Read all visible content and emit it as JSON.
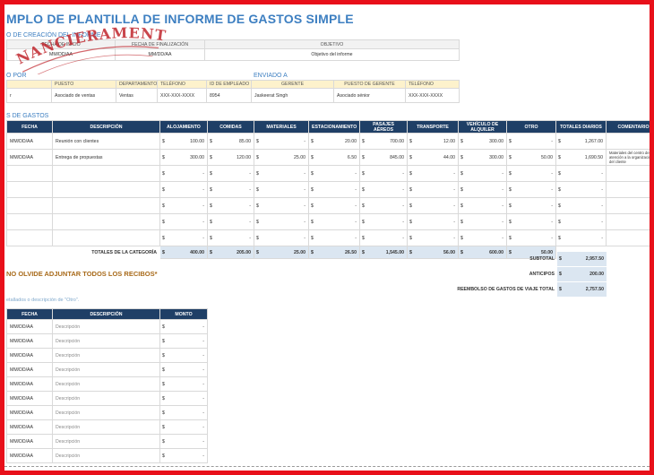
{
  "title": "MPLO DE PLANTILLA DE INFORME DE GASTOS SIMPLE",
  "watermark": "FINANCIERAMENTE",
  "period": {
    "label": "O DE CREACIÓN DEL INFORME",
    "headers": [
      "FECHA DE INICIO",
      "FECHA DE FINALIZACIÓN",
      "OBJETIVO"
    ],
    "values": [
      "MM/DD/AA",
      "MM/DD/AA",
      "Objetivo del informe"
    ]
  },
  "sent_by": {
    "label": "O POR",
    "headers": [
      "",
      "PUESTO",
      "DEPARTAMENTO",
      "TELÉFONO",
      "ID DE EMPLEADO"
    ],
    "values": [
      "r",
      "Asociado de ventas",
      "Ventas",
      "XXX-XXX-XXXX",
      "8954"
    ]
  },
  "sent_to": {
    "label": "ENVIADO A",
    "headers": [
      "GERENTE",
      "PUESTO DE GERENTE",
      "TELÉFONO"
    ],
    "values": [
      "Jaskeerat Singh",
      "Asociado sénior",
      "XXX-XXX-XXXX"
    ]
  },
  "expenses": {
    "label": "S DE GASTOS",
    "headers": [
      "FECHA",
      "DESCRIPCIÓN",
      "ALOJAMIENTO",
      "COMIDAS",
      "MATERIALES",
      "ESTACIONAMIENTO",
      "PASAJES AÉREOS",
      "TRANSPORTE",
      "VEHÍCULO DE ALQUILER",
      "OTRO",
      "TOTALES DIARIOS",
      "COMENTARIO"
    ],
    "rows": [
      {
        "date": "MM/DD/AA",
        "desc": "Reunión con clientes",
        "vals": [
          "100.00",
          "85.00",
          "-",
          "20.00",
          "700.00",
          "12.00",
          "300.00",
          "-",
          "1,267.00"
        ],
        "comment": ""
      },
      {
        "date": "MM/DD/AA",
        "desc": "Entrega de propuestas",
        "vals": [
          "300.00",
          "120.00",
          "25.00",
          "6.50",
          "845.00",
          "44.00",
          "300.00",
          "50.00",
          "1,690.50"
        ],
        "comment": "Materiales del centro de atención a la organización del cliente"
      },
      {
        "date": "",
        "desc": "",
        "vals": [
          "-",
          "-",
          "-",
          "-",
          "-",
          "-",
          "-",
          "-",
          "-"
        ],
        "comment": ""
      },
      {
        "date": "",
        "desc": "",
        "vals": [
          "-",
          "-",
          "-",
          "-",
          "-",
          "-",
          "-",
          "-",
          "-"
        ],
        "comment": ""
      },
      {
        "date": "",
        "desc": "",
        "vals": [
          "-",
          "-",
          "-",
          "-",
          "-",
          "-",
          "-",
          "-",
          "-"
        ],
        "comment": ""
      },
      {
        "date": "",
        "desc": "",
        "vals": [
          "-",
          "-",
          "-",
          "-",
          "-",
          "-",
          "-",
          "-",
          "-"
        ],
        "comment": ""
      },
      {
        "date": "",
        "desc": "",
        "vals": [
          "-",
          "-",
          "-",
          "-",
          "-",
          "-",
          "-",
          "-",
          "-"
        ],
        "comment": ""
      }
    ],
    "totals_label": "TOTALES DE LA CATEGORÍA",
    "totals": [
      "400.00",
      "205.00",
      "25.00",
      "26.50",
      "1,545.00",
      "56.00",
      "600.00",
      "50.00"
    ],
    "currency": "$"
  },
  "summary": [
    {
      "label": "SUBTOTAL",
      "value": "2,957.50"
    },
    {
      "label": "ANTICIPOS",
      "value": "200.00"
    },
    {
      "label": "REEMBOLSO DE GASTOS DE VIAJE TOTAL",
      "value": "2,757.50"
    }
  ],
  "note": "NO OLVIDE ADJUNTAR TODOS LOS RECIBOS*",
  "other": {
    "label": "etallados o descripción de \"Otro\".",
    "headers": [
      "FECHA",
      "DESCRIPCIÓN",
      "MONTO"
    ],
    "rows": [
      {
        "date": "MM/DD/AA",
        "desc": "Descripción",
        "amount": "-"
      },
      {
        "date": "MM/DD/AA",
        "desc": "Descripción",
        "amount": "-"
      },
      {
        "date": "MM/DD/AA",
        "desc": "Descripción",
        "amount": "-"
      },
      {
        "date": "MM/DD/AA",
        "desc": "Descripción",
        "amount": "-"
      },
      {
        "date": "MM/DD/AA",
        "desc": "Descripción",
        "amount": "-"
      },
      {
        "date": "MM/DD/AA",
        "desc": "Descripción",
        "amount": "-"
      },
      {
        "date": "MM/DD/AA",
        "desc": "Descripción",
        "amount": "-"
      },
      {
        "date": "MM/DD/AA",
        "desc": "Descripción",
        "amount": "-"
      },
      {
        "date": "MM/DD/AA",
        "desc": "Descripción",
        "amount": "-"
      },
      {
        "date": "MM/DD/AA",
        "desc": "Descripción",
        "amount": "-"
      }
    ]
  },
  "colors": {
    "border": "#e8101a",
    "title": "#3d7fc1",
    "header": "#1f3f66",
    "watermark": "#c0262d"
  }
}
